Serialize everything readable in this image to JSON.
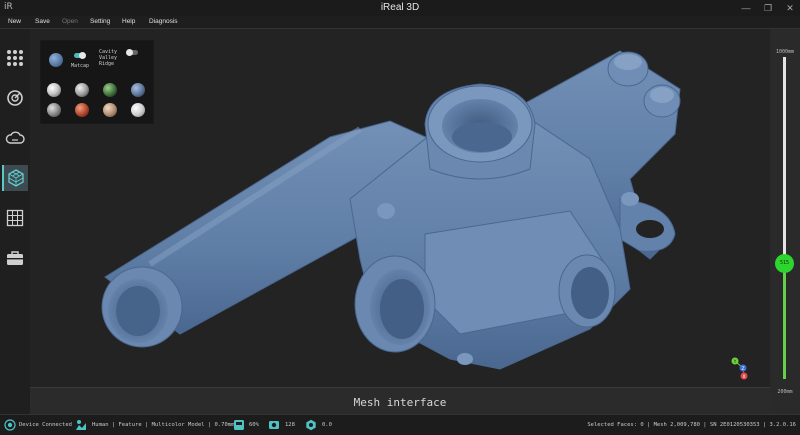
{
  "window": {
    "logo": "iR",
    "title": "iReal 3D",
    "controls": [
      "—",
      "❐",
      "✕"
    ]
  },
  "menu": [
    {
      "label": "New",
      "enabled": true
    },
    {
      "label": "Save",
      "enabled": true
    },
    {
      "label": "Open",
      "enabled": false
    },
    {
      "label": "Setting",
      "enabled": true
    },
    {
      "label": "Help",
      "enabled": true
    },
    {
      "label": "Diagnosis",
      "enabled": true
    }
  ],
  "sidebar": {
    "items": [
      {
        "name": "grid-dots-icon",
        "active": false
      },
      {
        "name": "scan-rotate-icon",
        "active": false
      },
      {
        "name": "cloud-icon",
        "active": false
      },
      {
        "name": "mesh-cube-icon",
        "active": true
      },
      {
        "name": "texture-grid-icon",
        "active": false
      },
      {
        "name": "toolbox-icon",
        "active": false
      }
    ]
  },
  "material_panel": {
    "matcap_label": "Matcap",
    "matcap_on": true,
    "options_label": "Cavity\nValley\nRidge",
    "options_on": false,
    "matcaps": [
      "#c8c8c8",
      "#b0b0b0",
      "#3f6e3a",
      "#5c7499",
      "#8a8a8a",
      "#b0442c",
      "#b08b70",
      "#d0d0d0"
    ],
    "selected_color": "#5a7aa6"
  },
  "viewport": {
    "label": "Mesh interface",
    "mesh_color": "#5f7ea6",
    "background": "#232323"
  },
  "axis_gizmo": {
    "y": "Y",
    "z": "Z",
    "x": "X"
  },
  "point_slider": {
    "top_label": "1000mm",
    "bottom_label": "200mm",
    "knob_label": "515",
    "fraction": 0.36
  },
  "status": {
    "device": "Device Connected",
    "mode": "Human | Feature | Multicolor Model | 0.70mm",
    "brightness": "60%",
    "frames": "128",
    "rate": "0.0",
    "info": "Selected Faces: 0 | Mesh   2,009,780 | SN  2E0120530353 | 3.2.0.16"
  }
}
